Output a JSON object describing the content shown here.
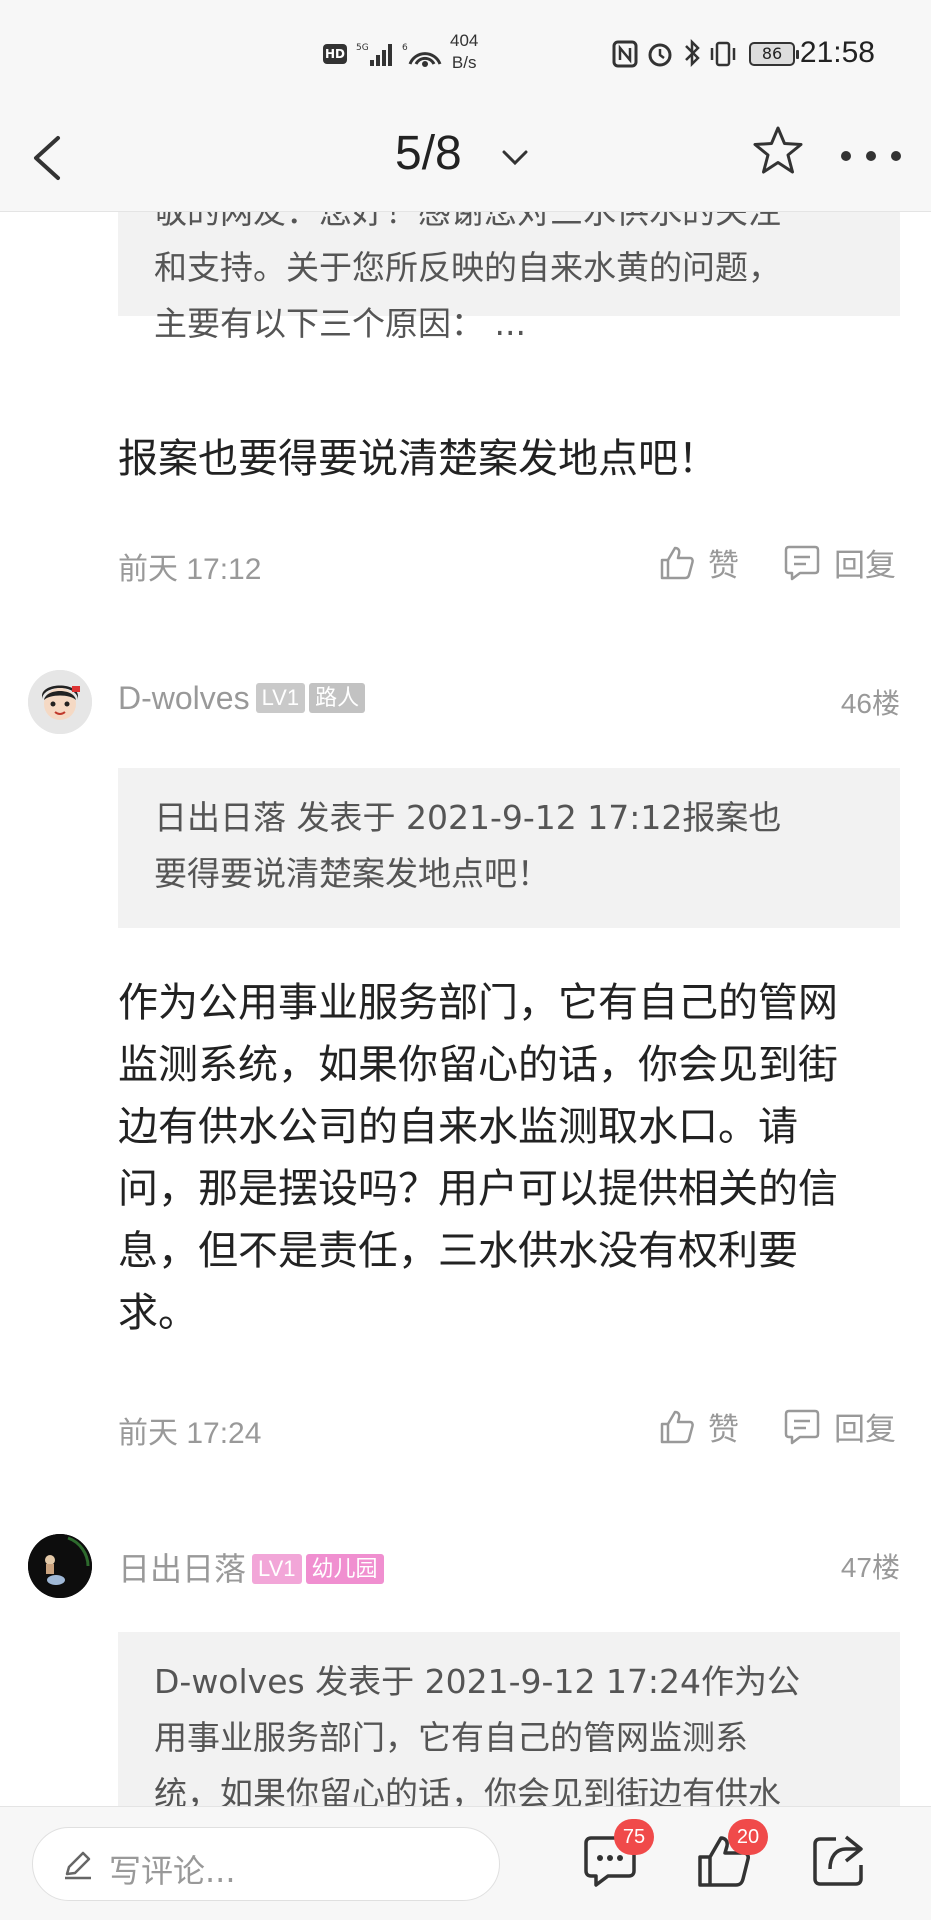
{
  "status_bar": {
    "hd": "HD",
    "net_speed_value": "404",
    "net_speed_unit": "B/s",
    "battery": "86",
    "time": "21:58"
  },
  "nav": {
    "page_indicator": "5/8"
  },
  "comments": [
    {
      "quote": "敬的网友：您好！感谢您对三水供水的关注和支持。关于您所反映的自来水黄的问题，主要有以下三个原因：  ...",
      "quote_lines": [
        "敬的网友：您好！感谢您对三水供水的关注",
        "和支持。关于您所反映的自来水黄的问题，",
        "主要有以下三个原因：  ..."
      ],
      "text": "报案也要得要说清楚案发地点吧！",
      "time": "前天 17:12",
      "like_label": "赞",
      "reply_label": "回复"
    },
    {
      "username": "D-wolves",
      "level": "LV1",
      "title_badge": "路人",
      "floor": "46楼",
      "quote_lines": [
        "日出日落 发表于 2021-9-12 17:12报案也",
        "要得要说清楚案发地点吧！"
      ],
      "text_lines": [
        "作为公用事业服务部门，它有自己的管网",
        "监测系统，如果你留心的话，你会见到街",
        "边有供水公司的自来水监测取水口。请",
        "问，那是摆设吗？用户可以提供相关的信",
        "息，但不是责任，三水供水没有权利要",
        "求。"
      ],
      "time": "前天 17:24",
      "like_label": "赞",
      "reply_label": "回复"
    },
    {
      "username": "日出日落",
      "level": "LV1",
      "title_badge": "幼儿园",
      "floor": "47楼",
      "quote_lines": [
        "D-wolves 发表于 2021-9-12 17:24作为公",
        "用事业服务部门，它有自己的管网监测系",
        "统，如果你留心的话，你会见到街边有供水"
      ]
    }
  ],
  "bottom_bar": {
    "comment_placeholder": "写评论...",
    "comment_count": "75",
    "like_count": "20"
  },
  "colors": {
    "level_badge": "#c9c9c9",
    "title_badge_gray": "#c2c2c2",
    "level_badge_pink": "#f2a6d8",
    "title_badge_pink": "#f08fd0",
    "count_badge": "#f04a4a"
  }
}
